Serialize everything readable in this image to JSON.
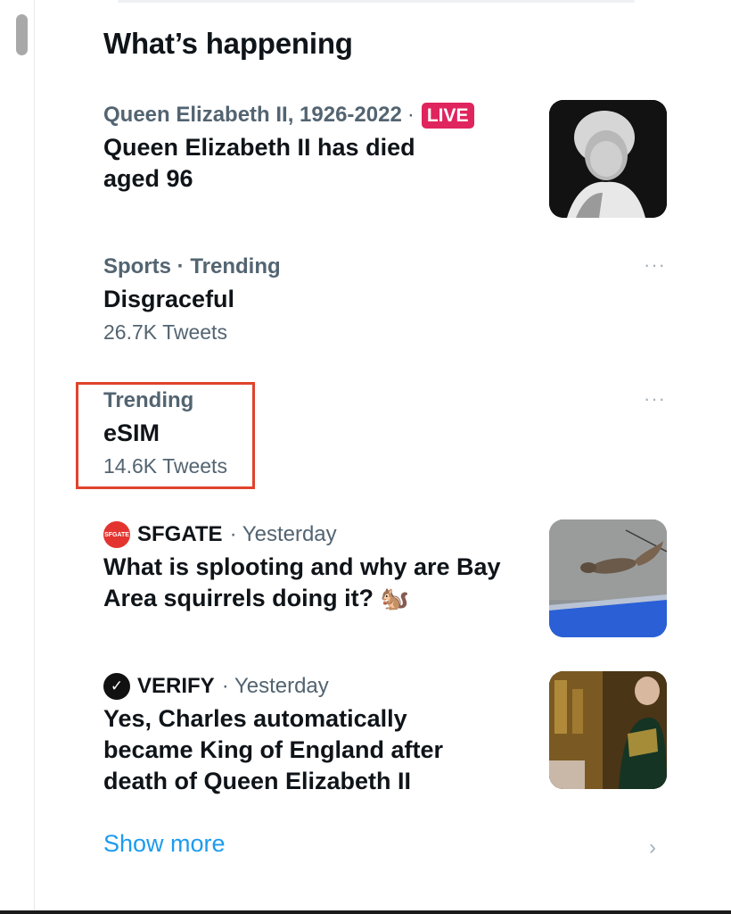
{
  "section_title": "What’s happening",
  "trends": [
    {
      "category": "Queen Elizabeth II, 1926-2022",
      "separator": "·",
      "badge": "LIVE",
      "headline_line1": "Queen Elizabeth II has died",
      "headline_line2": "aged 96"
    },
    {
      "category": "Sports · Trending",
      "topic": "Disgraceful",
      "tweet_count": "26.7K Tweets",
      "more": "···"
    },
    {
      "category": "Trending",
      "topic": "eSIM",
      "tweet_count": "14.6K Tweets",
      "more": "···"
    },
    {
      "source": "SFGATE",
      "source_logo_text": "SFGATE",
      "time": "· Yesterday",
      "headline_line1": "What is splooting and why are Bay",
      "headline_line2": "Area squirrels doing it?",
      "emoji": "🐿️"
    },
    {
      "source": "VERIFY",
      "source_logo_text": "✓",
      "time": "· Yesterday",
      "headline_line1": "Yes, Charles automatically",
      "headline_line2": "became King of England after",
      "headline_line3": "death of Queen Elizabeth II"
    }
  ],
  "show_more": "Show more",
  "chevron": "›",
  "colors": {
    "accent": "#1d9bf0",
    "live": "#e0245e",
    "highlight": "#e0432c",
    "secondary_text": "#536471"
  }
}
